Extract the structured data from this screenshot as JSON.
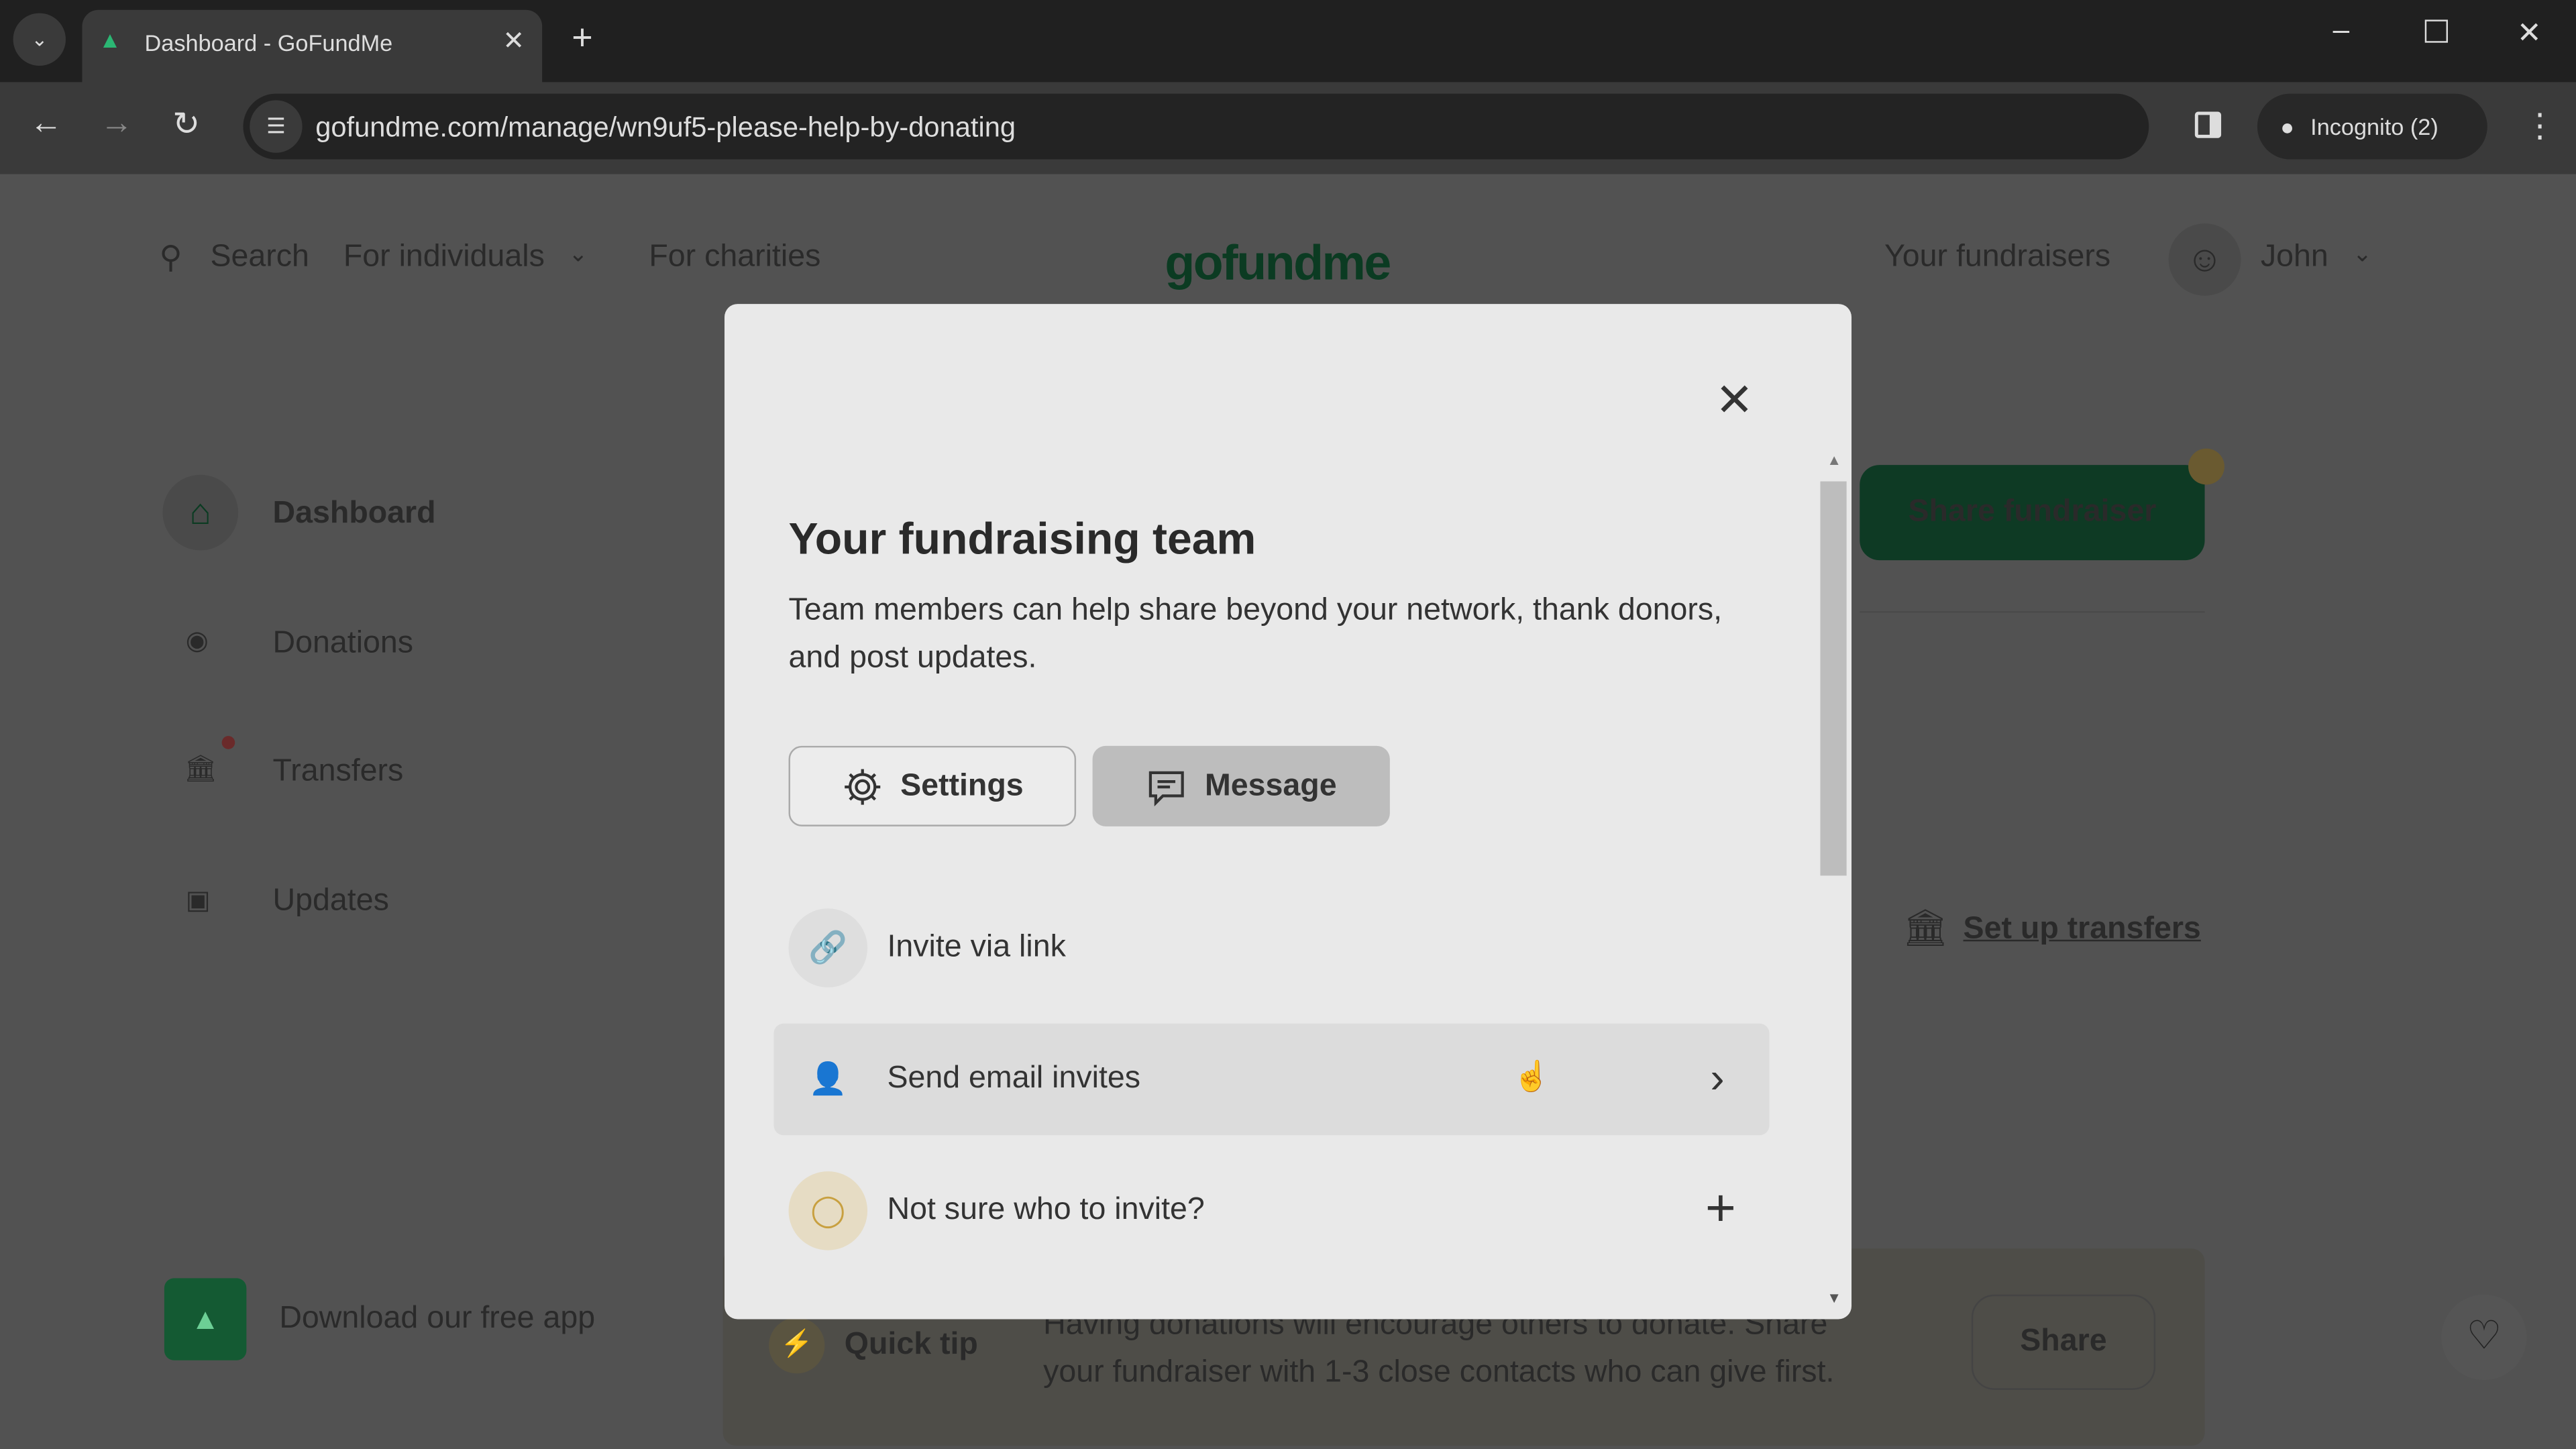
{
  "browser": {
    "tab_title": "Dashboard - GoFundMe",
    "url": "gofundme.com/manage/wn9uf5-please-help-by-donating",
    "incognito": "Incognito (2)"
  },
  "header": {
    "search": "Search",
    "for_individuals": "For individuals",
    "for_charities": "For charities",
    "logo": "gofundme",
    "your_fundraisers": "Your fundraisers",
    "user": "John"
  },
  "sidebar": {
    "items": [
      {
        "label": "Dashboard"
      },
      {
        "label": "Donations"
      },
      {
        "label": "Transfers"
      },
      {
        "label": "Updates"
      }
    ],
    "download_app": "Download our free app"
  },
  "main": {
    "share_fundraiser": "Share fundraiser",
    "set_up_transfers": "Set up transfers",
    "quick_tip_label": "Quick tip",
    "quick_tip_text": "Having donations will encourage others to donate. Share your fundraiser with 1-3 close contacts who can give first.",
    "share": "Share"
  },
  "modal": {
    "title": "Your fundraising team",
    "description": "Team members can help share beyond your network, thank donors, and post updates.",
    "settings": "Settings",
    "message": "Message",
    "invite_link": "Invite via link",
    "email_invites": "Send email invites",
    "not_sure": "Not sure who to invite?"
  },
  "colors": {
    "brand": "#0b4a2a",
    "overlay": "#525252",
    "modal": "#e9e9e9"
  }
}
